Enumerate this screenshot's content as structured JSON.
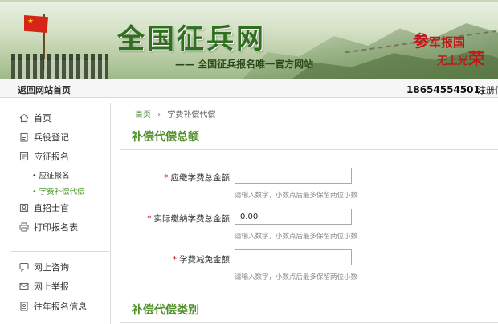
{
  "banner": {
    "title": "全国征兵网",
    "subtitle": "—— 全国征兵报名唯一官方网站",
    "slogan_line1_a": "参",
    "slogan_line1_b": "军报国",
    "slogan_line2_a": "无上光",
    "slogan_line2_b": "荣"
  },
  "topnav": {
    "back": "返回网站首页",
    "phone": "18654554501，",
    "register": "注册信"
  },
  "sidebar": {
    "items": [
      {
        "label": "首页",
        "icon": "home-icon"
      },
      {
        "label": "兵役登记",
        "icon": "clipboard-icon"
      },
      {
        "label": "应征报名",
        "icon": "form-icon"
      },
      {
        "label": "直招士官",
        "icon": "badge-icon"
      },
      {
        "label": "打印报名表",
        "icon": "printer-icon"
      },
      {
        "label": "网上咨询",
        "icon": "chat-icon"
      },
      {
        "label": "网上举报",
        "icon": "mail-icon"
      },
      {
        "label": "往年报名信息",
        "icon": "document-icon"
      }
    ],
    "subitems": [
      {
        "label": "• 应征报名"
      },
      {
        "label": "• 学费补偿代偿"
      }
    ]
  },
  "breadcrumb": {
    "home": "首页",
    "separator": "›",
    "current": "学费补偿代偿"
  },
  "section1": {
    "title": "补偿代偿总额"
  },
  "section2": {
    "title": "补偿代偿类别"
  },
  "form": {
    "fields": [
      {
        "label": "应缴学费总金额",
        "value": "",
        "hint": "请输入数字，小数点后最多保留两位小数"
      },
      {
        "label": "实际缴纳学费总金额",
        "value": "0.00",
        "hint": "请输入数字，小数点后最多保留两位小数"
      },
      {
        "label": "学费减免金额",
        "value": "",
        "hint": "请输入数字，小数点后最多保留两位小数"
      }
    ],
    "required_mark": "*"
  },
  "colors": {
    "accent_green": "#4f8f2a",
    "required_red": "#d20000",
    "slogan_red": "#c01818"
  }
}
